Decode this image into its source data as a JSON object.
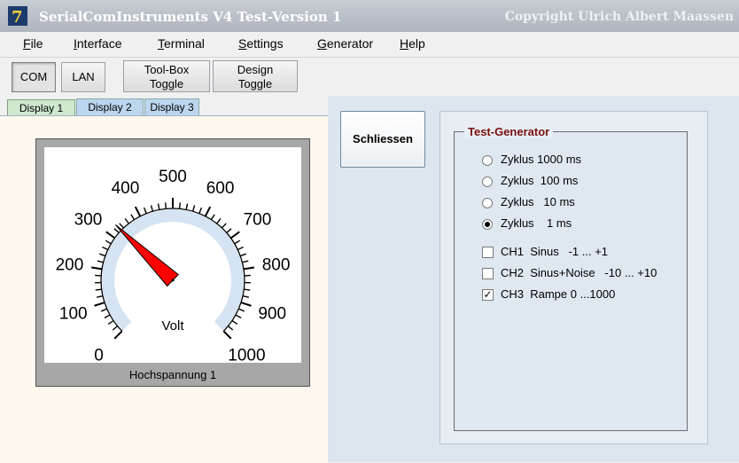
{
  "window": {
    "title": "SerialComInstruments V4   Test-Version 1",
    "copyright": "Copyright Ulrich Albert Maassen",
    "app_icon_glyph": "7"
  },
  "menu": [
    {
      "label": "File",
      "mnemonic": "F",
      "rest": "ile"
    },
    {
      "label": "Interface",
      "mnemonic": "I",
      "rest": "nterface"
    },
    {
      "label": "Terminal",
      "mnemonic": "T",
      "rest": "erminal"
    },
    {
      "label": "Settings",
      "mnemonic": "S",
      "rest": "ettings"
    },
    {
      "label": "Generator",
      "mnemonic": "G",
      "rest": "enerator"
    },
    {
      "label": "Help",
      "mnemonic": "H",
      "rest": "elp"
    }
  ],
  "toolbar": {
    "com": "COM",
    "lan": "LAN",
    "toolbox_line1": "Tool-Box",
    "toolbox_line2": "Toggle",
    "design_line1": "Design",
    "design_line2": "Toggle"
  },
  "tabs": [
    "Display 1",
    "Display 2",
    "Display 3"
  ],
  "active_tab": "Display 1",
  "gauge": {
    "min": 0,
    "max": 1000,
    "labels": [
      "0",
      "100",
      "200",
      "300",
      "400",
      "500",
      "600",
      "700",
      "800",
      "900",
      "1000"
    ],
    "unit": "Volt",
    "value": 330,
    "caption": "Hochspannung 1",
    "needle_color": "#ff0000",
    "band_color": "#d5e3f2"
  },
  "close_button": "Schliessen",
  "generator": {
    "legend": "Test-Generator",
    "legend_color": "#7b1010",
    "cycles": [
      {
        "label": "Zyklus 1000 ms",
        "selected": false
      },
      {
        "label": "Zyklus  100 ms",
        "selected": false
      },
      {
        "label": "Zyklus   10 ms",
        "selected": false
      },
      {
        "label": "Zyklus    1 ms",
        "selected": true
      }
    ],
    "channels": [
      {
        "label": "CH1  Sinus   -1 ... +1",
        "checked": false
      },
      {
        "label": "CH2  Sinus+Noise   -10 ... +10",
        "checked": false
      },
      {
        "label": "CH3  Rampe 0 ...1000",
        "checked": true
      }
    ]
  }
}
